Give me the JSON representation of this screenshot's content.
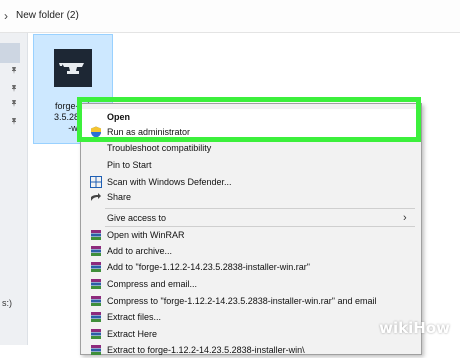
{
  "breadcrumb": {
    "chevron": "›",
    "label": "New folder (2)"
  },
  "nav": {
    "pins": [
      "pin-icon",
      "pin-icon",
      "pin-icon",
      "pin-icon"
    ],
    "bottom_text": "s:)"
  },
  "file": {
    "name_lines": [
      "forge-1.1",
      "3.5.2838-",
      "-w"
    ],
    "icon": "anvil-icon"
  },
  "context_menu": {
    "items": [
      {
        "label": "Open",
        "bold": true,
        "icon": ""
      },
      {
        "label": "Run as administrator",
        "bold": false,
        "icon": "shield-icon"
      },
      {
        "label": "Troubleshoot compatibility",
        "bold": false,
        "icon": ""
      },
      {
        "label": "Pin to Start",
        "bold": false,
        "icon": ""
      },
      {
        "label": "Scan with Windows Defender...",
        "bold": false,
        "icon": "defender-icon"
      },
      {
        "label": "Share",
        "bold": false,
        "icon": "share-icon"
      },
      {
        "label": "Give access to",
        "bold": false,
        "icon": "",
        "submenu": "›"
      },
      {
        "label": "Open with WinRAR",
        "bold": false,
        "icon": "winrar-icon"
      },
      {
        "label": "Add to archive...",
        "bold": false,
        "icon": "winrar-icon"
      },
      {
        "label": "Add to \"forge-1.12.2-14.23.5.2838-installer-win.rar\"",
        "bold": false,
        "icon": "winrar-icon"
      },
      {
        "label": "Compress and email...",
        "bold": false,
        "icon": "winrar-icon"
      },
      {
        "label": "Compress to \"forge-1.12.2-14.23.5.2838-installer-win.rar\" and email",
        "bold": false,
        "icon": "winrar-icon"
      },
      {
        "label": "Extract files...",
        "bold": false,
        "icon": "winrar-icon"
      },
      {
        "label": "Extract Here",
        "bold": false,
        "icon": "winrar-icon"
      },
      {
        "label": "Extract to forge-1.12.2-14.23.5.2838-installer-win\\",
        "bold": false,
        "icon": "winrar-icon"
      }
    ]
  },
  "colors": {
    "highlight_box": "#3cf03c",
    "selection": "#cde8ff"
  },
  "watermark": {
    "wiki": "wiki",
    "how": "How"
  }
}
